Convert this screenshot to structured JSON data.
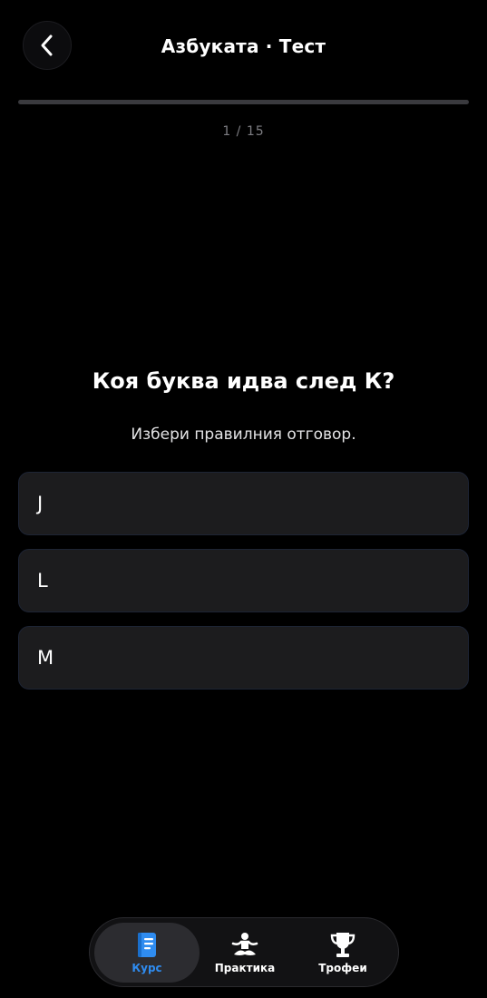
{
  "header": {
    "title": "Азбуката · Тест",
    "back_icon": "chevron-left-icon"
  },
  "progress": {
    "current": 1,
    "total": 15,
    "label": "1 / 15",
    "fraction": 0.0
  },
  "question": {
    "title": "Коя буква идва след К?",
    "hint": "Избери правилния отговор."
  },
  "answers": [
    {
      "label": "J"
    },
    {
      "label": "L"
    },
    {
      "label": "M"
    }
  ],
  "tab_bar": {
    "tabs": [
      {
        "label": "Курс",
        "icon": "book-icon",
        "active": true
      },
      {
        "label": "Практика",
        "icon": "meditation-icon",
        "active": false
      },
      {
        "label": "Трофеи",
        "icon": "trophy-icon",
        "active": false
      }
    ]
  },
  "colors": {
    "background": "#000000",
    "accent": "#2f8cf0",
    "option_background": "#1c1c1e",
    "muted_text": "#7d7d82"
  }
}
